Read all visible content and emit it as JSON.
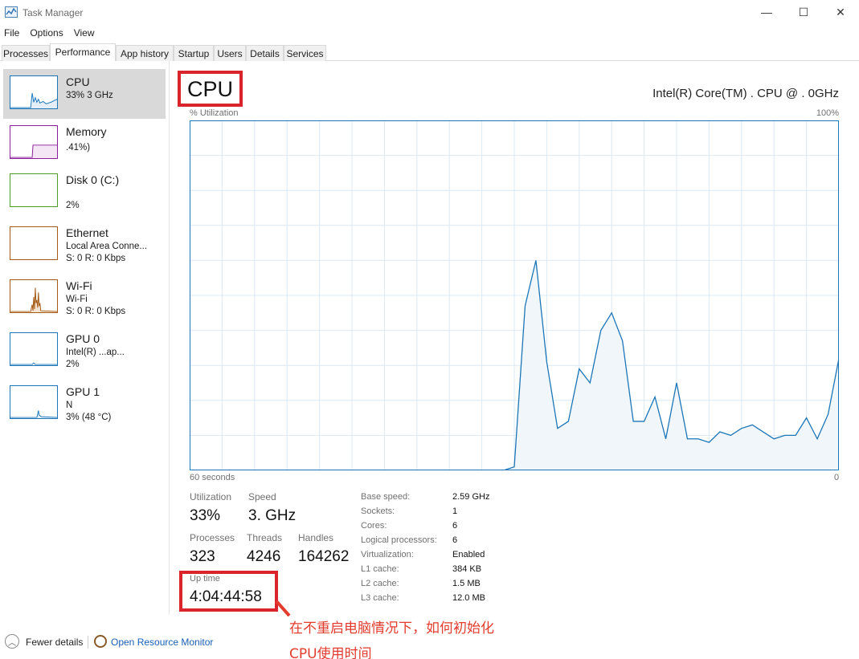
{
  "window": {
    "title": "Task Manager",
    "minimize": "—",
    "maximize": "☐",
    "close": "✕"
  },
  "menu": [
    "File",
    "Options",
    "View"
  ],
  "tabs": [
    "Processes",
    "Performance",
    "App history",
    "Startup",
    "Users",
    "Details",
    "Services"
  ],
  "active_tab": "Performance",
  "sidebar": [
    {
      "name": "CPU",
      "line1": "33%  3     GHz",
      "line2": "",
      "color": "#1b76b7"
    },
    {
      "name": "Memory",
      "line1": "                   .41%)",
      "line2": "",
      "color": "#8b1e9a"
    },
    {
      "name": "Disk 0 (C:)",
      "line1": "",
      "line2": "2%",
      "color": "#4f9e21"
    },
    {
      "name": "Ethernet",
      "line1": "Local Area Conne...",
      "line2": "S: 0 R: 0 Kbps",
      "color": "#a45a15"
    },
    {
      "name": "Wi-Fi",
      "line1": "Wi-Fi",
      "line2": "S: 0 R: 0 Kbps",
      "color": "#a45a15"
    },
    {
      "name": "GPU 0",
      "line1": "Intel(R)     ...ap...",
      "line2": "2%",
      "color": "#1b76b7"
    },
    {
      "name": "GPU 1",
      "line1": "N",
      "line2": "3% (48 °C)",
      "color": "#1b76b7"
    }
  ],
  "main": {
    "title": "CPU",
    "model": "Intel(R) Core(TM)                    . CPU @ .    0GHz",
    "util_label": "% Utilization",
    "max_label": "100%",
    "time_label": "60 seconds",
    "min_label": "0",
    "stats": {
      "utilization_label": "Utilization",
      "utilization": "33%",
      "speed_label": "Speed",
      "speed": "3.    GHz",
      "processes_label": "Processes",
      "processes": "323",
      "threads_label": "Threads",
      "threads": "4246",
      "handles_label": "Handles",
      "handles": "164262",
      "uptime_label": "Up time",
      "uptime": "4:04:44:58"
    },
    "info": [
      {
        "label": "Base speed:",
        "value": "2.59 GHz"
      },
      {
        "label": "Sockets:",
        "value": "1"
      },
      {
        "label": "Cores:",
        "value": "6"
      },
      {
        "label": "Logical processors:",
        "value": "6"
      },
      {
        "label": "Virtualization:",
        "value": "Enabled"
      },
      {
        "label": "L1 cache:",
        "value": "384 KB"
      },
      {
        "label": "L2 cache:",
        "value": "1.5 MB"
      },
      {
        "label": "L3 cache:",
        "value": "12.0 MB"
      }
    ]
  },
  "chart_data": {
    "type": "area",
    "x": [
      0,
      1,
      2,
      3,
      4,
      5,
      6,
      7,
      8,
      9,
      10,
      11,
      12,
      13,
      14,
      15,
      16,
      17,
      18,
      19,
      20,
      21,
      22,
      23,
      24,
      25,
      26,
      27,
      28,
      29,
      30,
      31,
      32,
      33,
      34,
      35,
      36,
      37,
      38,
      39,
      40,
      41,
      42,
      43,
      44,
      45,
      46,
      47,
      48,
      49,
      50,
      51,
      52,
      53,
      54,
      55,
      56,
      57,
      58,
      59,
      60
    ],
    "values": [
      0,
      0,
      0,
      0,
      0,
      0,
      0,
      0,
      0,
      0,
      0,
      0,
      0,
      0,
      0,
      0,
      0,
      0,
      0,
      0,
      0,
      0,
      0,
      0,
      0,
      0,
      0,
      0,
      0,
      0,
      0,
      0,
      0,
      0,
      0,
      0,
      0,
      0,
      0,
      0,
      0,
      0,
      0,
      0,
      0,
      0,
      0,
      0,
      0,
      0,
      0,
      0,
      0,
      0,
      0,
      0,
      0,
      0,
      0,
      0,
      33
    ],
    "series_values": [
      0,
      0,
      0,
      0,
      0,
      0,
      0,
      0,
      0,
      0,
      0,
      0,
      0,
      0,
      0,
      0,
      0,
      0,
      0,
      0,
      0,
      0,
      0,
      0,
      0,
      0,
      0,
      0,
      0,
      0,
      1,
      47,
      60,
      31,
      12,
      14,
      29,
      25,
      40,
      45,
      37,
      14,
      14,
      21,
      9,
      25,
      9,
      9,
      8,
      11,
      10,
      12,
      13,
      11,
      9,
      10,
      10,
      15,
      9,
      16,
      32
    ],
    "ylim": [
      0,
      100
    ],
    "xlim": [
      0,
      60
    ],
    "grid": true,
    "fill_color": "#f1f6fb",
    "line_color": "#1b76b7"
  },
  "bottom": {
    "fewer_details": "Fewer details",
    "open_resmon": "Open Resource Monitor"
  },
  "annotation": {
    "line1": "在不重启电脑情况下，如何初始化",
    "line2": "CPU使用时间",
    "color": "#e33b2d"
  }
}
